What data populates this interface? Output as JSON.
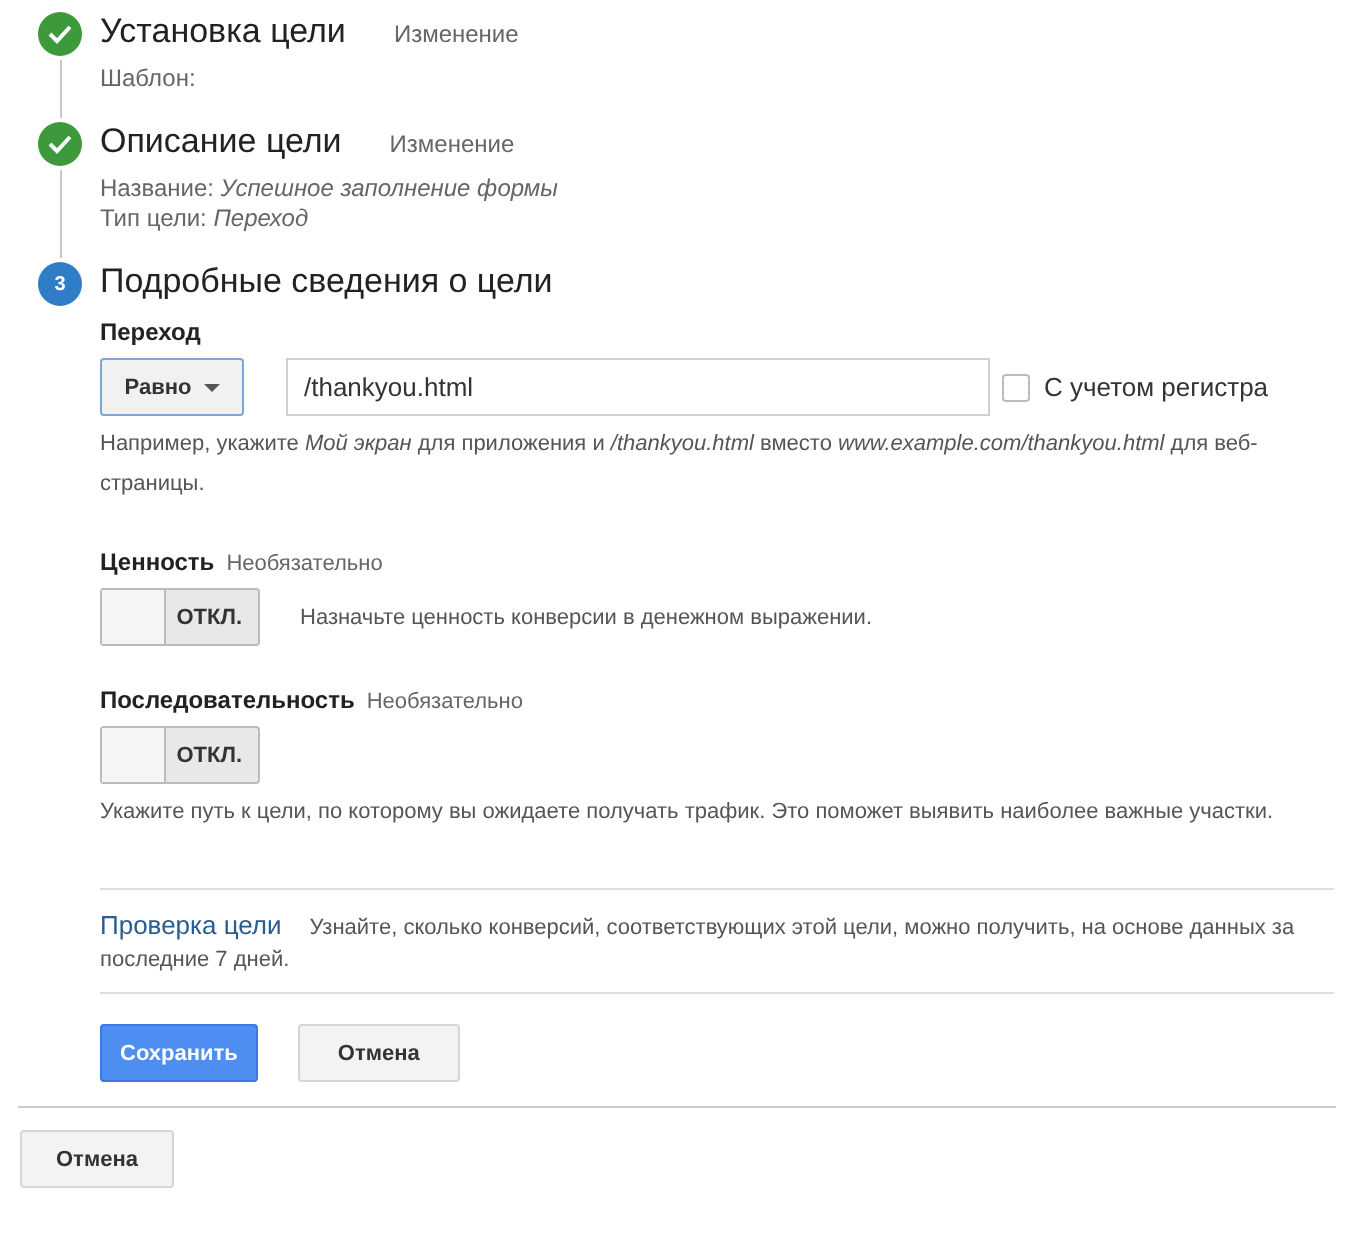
{
  "steps": [
    {
      "kind": "done",
      "title": "Установка цели",
      "edit_link": "Изменение",
      "details": [
        "Шаблон:"
      ]
    },
    {
      "kind": "done",
      "title": "Описание цели",
      "edit_link": "Изменение",
      "details": [
        "Название: *Успешное заполнение формы*",
        "Тип цели: *Переход*"
      ]
    },
    {
      "kind": "current",
      "number": "3",
      "title": "Подробные сведения о цели"
    }
  ],
  "destination": {
    "label": "Переход",
    "match_dropdown": "Равно",
    "value": "/thankyou.html",
    "case_sensitive": {
      "label": "С учетом регистра",
      "checked": false
    },
    "hint": "Например, укажите *Мой экран* для приложения и */thankyou.html* вместо *www.example.com/thankyou.html* для веб-страницы."
  },
  "value_setting": {
    "label": "Ценность",
    "optional": "Необязательно",
    "toggle": {
      "on": false,
      "label": "ОТКЛ."
    },
    "description": "Назначьте ценность конверсии в денежном выражении."
  },
  "funnel_setting": {
    "label": "Последовательность",
    "optional": "Необязательно",
    "toggle": {
      "on": false,
      "label": "ОТКЛ."
    },
    "description": "Укажите путь к цели, по которому вы ожидаете получать трафик. Это поможет выявить наиболее важные участки."
  },
  "verify": {
    "link": "Проверка цели",
    "text": "Узнайте, сколько конверсий, соответствующих этой цели, можно получить, на основе данных за последние 7 дней."
  },
  "buttons": [
    {
      "label": "Сохранить",
      "kind": "primary"
    },
    {
      "label": "Отмена",
      "kind": "secondary"
    }
  ],
  "footer_button": "Отмена"
}
